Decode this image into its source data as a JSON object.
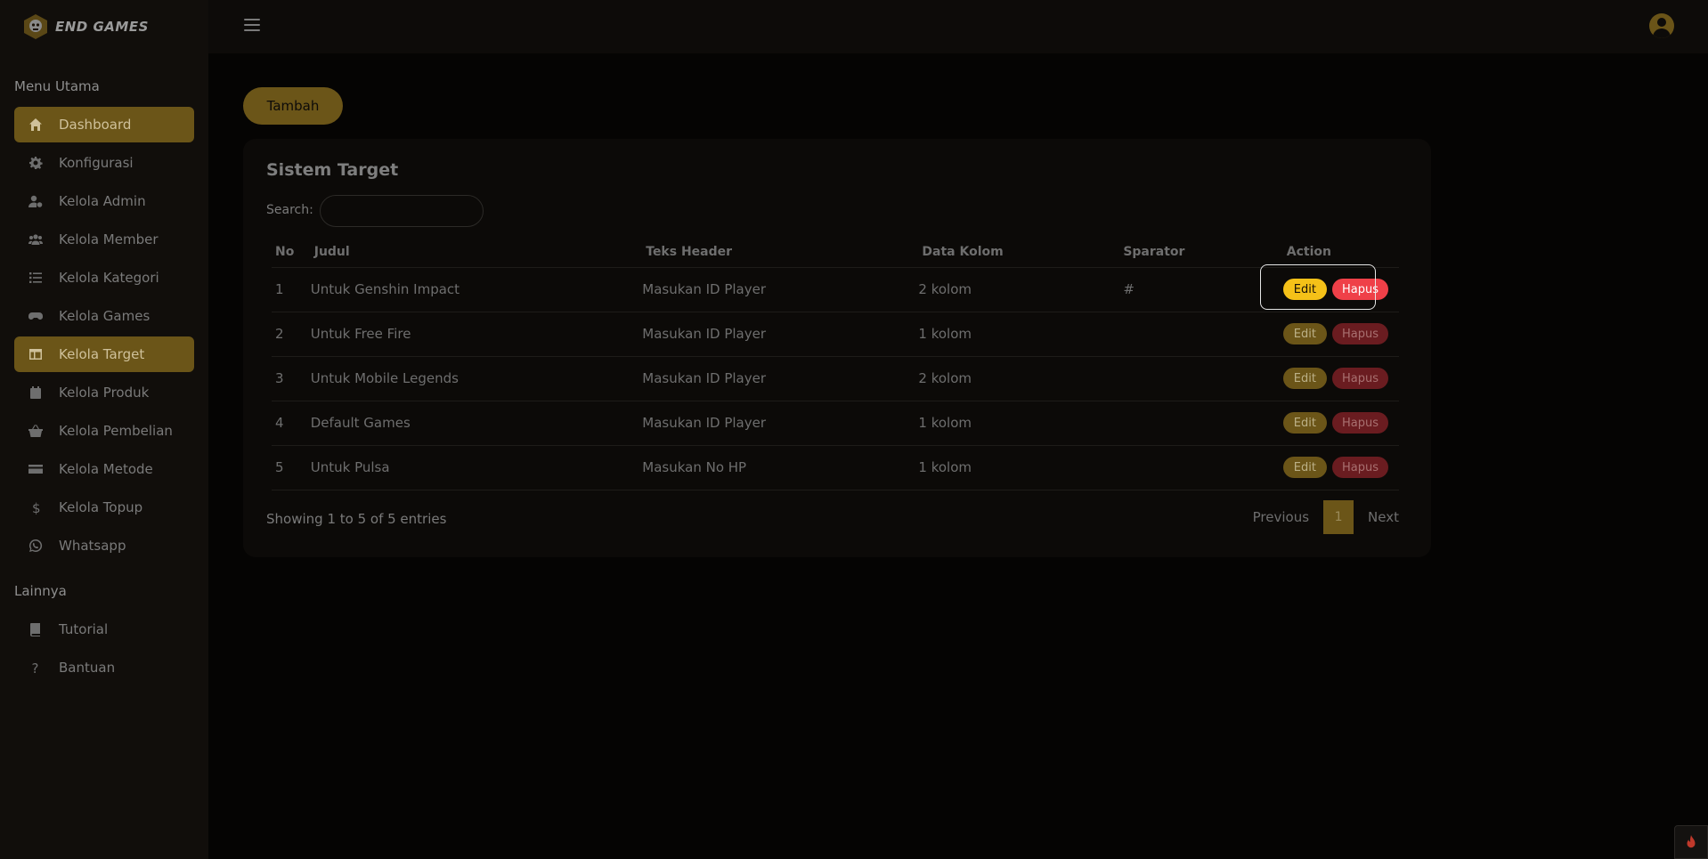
{
  "brand": {
    "name": "END GAMES"
  },
  "sidebar": {
    "section_main": "Menu Utama",
    "items": [
      {
        "label": "Dashboard",
        "icon": "home-icon",
        "active": true
      },
      {
        "label": "Konfigurasi",
        "icon": "gear-icon"
      },
      {
        "label": "Kelola Admin",
        "icon": "user-gear-icon"
      },
      {
        "label": "Kelola Member",
        "icon": "users-icon"
      },
      {
        "label": "Kelola Kategori",
        "icon": "list-icon"
      },
      {
        "label": "Kelola Games",
        "icon": "gamepad-icon"
      },
      {
        "label": "Kelola Target",
        "icon": "table-icon",
        "active": true
      },
      {
        "label": "Kelola Produk",
        "icon": "calendar-icon"
      },
      {
        "label": "Kelola Pembelian",
        "icon": "basket-icon"
      },
      {
        "label": "Kelola Metode",
        "icon": "card-icon"
      },
      {
        "label": "Kelola Topup",
        "icon": "dollar-icon"
      },
      {
        "label": "Whatsapp",
        "icon": "whatsapp-icon"
      }
    ],
    "section_other": "Lainnya",
    "other_items": [
      {
        "label": "Tutorial",
        "icon": "book-icon"
      },
      {
        "label": "Bantuan",
        "icon": "question-icon"
      }
    ]
  },
  "main": {
    "add_button": "Tambah",
    "card_title": "Sistem Target",
    "search_label": "Search:",
    "search_value": "",
    "columns": [
      "No",
      "Judul",
      "Teks Header",
      "Data Kolom",
      "Sparator",
      "Action"
    ],
    "rows": [
      {
        "no": "1",
        "judul": "Untuk Genshin Impact",
        "teks": "Masukan ID Player",
        "data": "2 kolom",
        "sparator": "#"
      },
      {
        "no": "2",
        "judul": "Untuk Free Fire",
        "teks": "Masukan ID Player",
        "data": "1 kolom",
        "sparator": ""
      },
      {
        "no": "3",
        "judul": "Untuk Mobile Legends",
        "teks": "Masukan ID Player",
        "data": "2 kolom",
        "sparator": ""
      },
      {
        "no": "4",
        "judul": "Default Games",
        "teks": "Masukan ID Player",
        "data": "1 kolom",
        "sparator": ""
      },
      {
        "no": "5",
        "judul": "Untuk Pulsa",
        "teks": "Masukan No HP",
        "data": "1 kolom",
        "sparator": ""
      }
    ],
    "edit_label": "Edit",
    "delete_label": "Hapus",
    "info": "Showing 1 to 5 of 5 entries",
    "pager": {
      "prev": "Previous",
      "current": "1",
      "next": "Next"
    }
  },
  "colors": {
    "accent": "#6b5518",
    "edit_active": "#f5c118",
    "delete_active": "#ef4048"
  }
}
